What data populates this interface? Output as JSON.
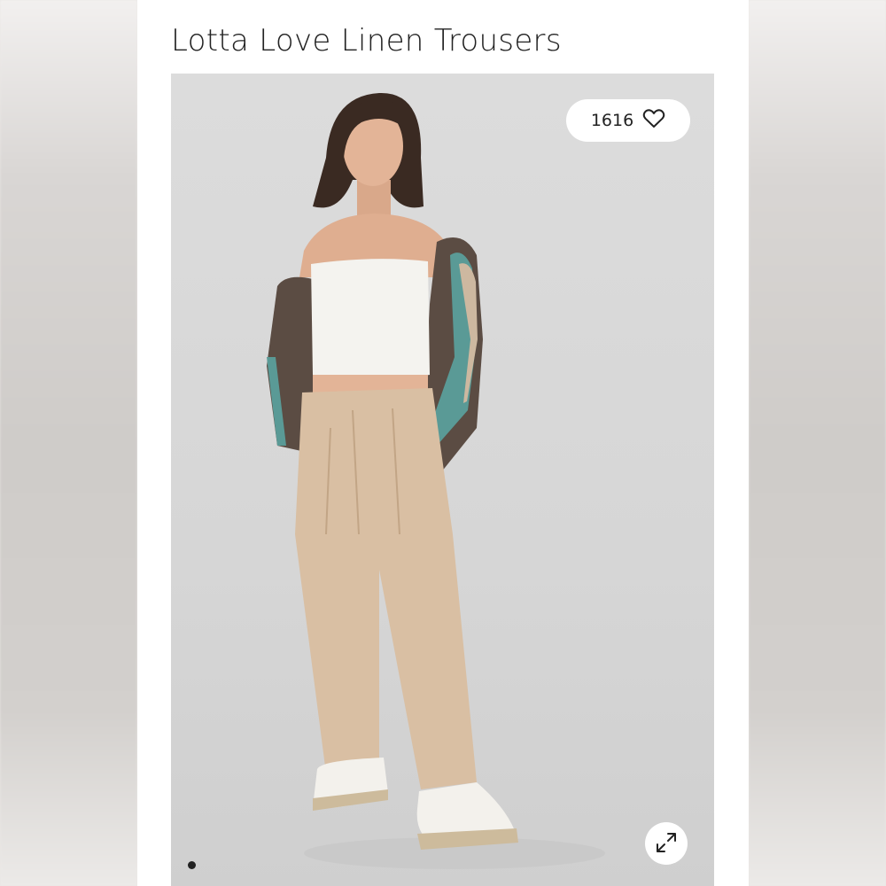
{
  "product": {
    "title": "Lotta Love Linen Trousers"
  },
  "likes": {
    "count": "1616",
    "icon": "heart-outline-icon"
  },
  "gallery": {
    "expand_icon": "expand-arrows-icon",
    "active_dot_index": 0,
    "dot_count": 1
  },
  "colors": {
    "page_background": "#e9e6e4",
    "card_background": "#ffffff",
    "photo_background": "#d8d8d8",
    "trousers": "#d9bfa3",
    "top": "#f4f3ef",
    "jacket_teal": "#5a9a96",
    "jacket_brown": "#5b4c43"
  }
}
